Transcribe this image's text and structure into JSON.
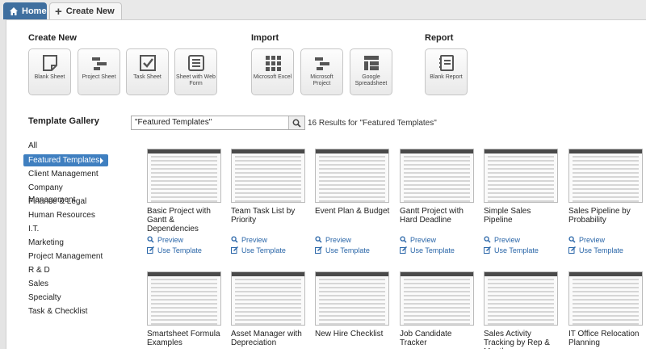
{
  "tabs": {
    "home": "Home",
    "create_new": "Create New"
  },
  "sections": {
    "create_new": "Create New",
    "import": "Import",
    "report": "Report"
  },
  "tiles": {
    "blank_sheet": "Blank Sheet",
    "project_sheet": "Project Sheet",
    "task_sheet": "Task Sheet",
    "web_form": "Sheet with Web Form",
    "excel": "Microsoft Excel",
    "ms_project": "Microsoft Project",
    "google": "Google Spreadsheet",
    "blank_report": "Blank Report"
  },
  "gallery": {
    "title": "Template Gallery",
    "search_value": "\"Featured Templates\"",
    "results": "16 Results for \"Featured Templates\"",
    "preview_label": "Preview",
    "use_label": "Use Template"
  },
  "categories": [
    "All",
    "Featured Templates",
    "Client Management",
    "Company Management",
    "Finance & Legal",
    "Human Resources",
    "I.T.",
    "Marketing",
    "Project Management",
    "R & D",
    "Sales",
    "Specialty",
    "Task & Checklist"
  ],
  "templates": [
    "Basic Project with Gantt & Dependencies",
    "Team Task List by Priority",
    "Event Plan & Budget",
    "Gantt Project with Hard Deadline",
    "Simple Sales Pipeline",
    "Sales Pipeline by Probability",
    "Smartsheet Formula Examples",
    "Asset Manager with Depreciation",
    "New Hire Checklist",
    "Job Candidate Tracker",
    "Sales Activity Tracking by Rep & Month",
    "IT Office Relocation Planning"
  ],
  "colors": {
    "accent": "#3f7fc0",
    "tab_home": "#3f6f9f",
    "link": "#2a66a8"
  }
}
